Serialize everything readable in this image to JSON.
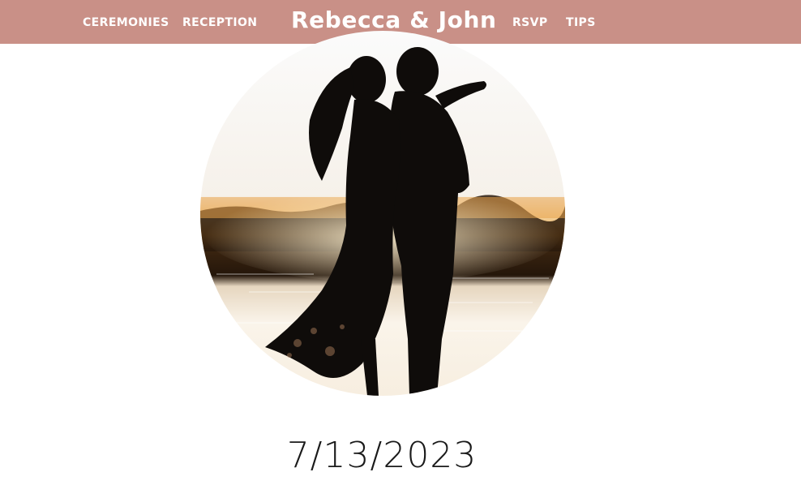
{
  "nav": {
    "left_links": [
      "CEREMONIES",
      "RECEPTION"
    ],
    "brand": "Rebecca & John",
    "right_links": [
      "RSVP",
      "TIPS"
    ]
  },
  "hero": {
    "image_icon": "couple-silhouette-sunset-photo"
  },
  "event": {
    "date": "7/13/2023"
  },
  "colors": {
    "nav_background": "#c99087",
    "nav_text": "#ffffff",
    "date_text": "#1a1a1a"
  }
}
